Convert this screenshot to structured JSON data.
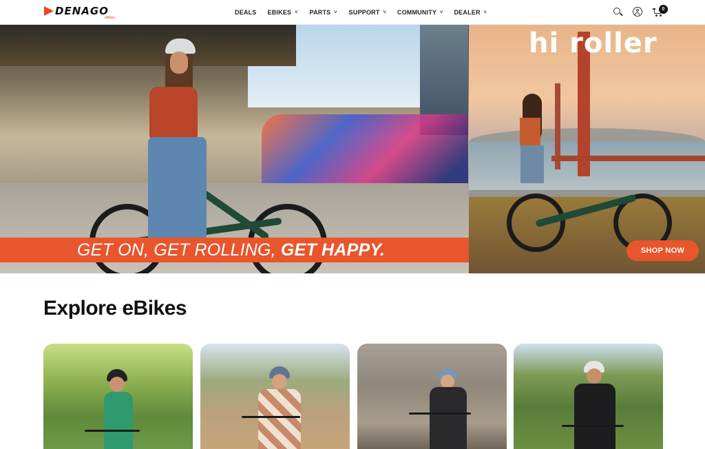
{
  "brand": {
    "name": "DENAGO",
    "tagline": "eBikes",
    "accent_color": "#e9552c"
  },
  "nav": {
    "items": [
      {
        "label": "DEALS",
        "has_dropdown": false
      },
      {
        "label": "EBIKES",
        "has_dropdown": true
      },
      {
        "label": "PARTS",
        "has_dropdown": true
      },
      {
        "label": "SUPPORT",
        "has_dropdown": true
      },
      {
        "label": "COMMUNITY",
        "has_dropdown": true
      },
      {
        "label": "DEALER",
        "has_dropdown": true
      }
    ],
    "chevron": "˅"
  },
  "header_icons": {
    "search": "search-icon",
    "account": "user-icon",
    "cart": "cart-icon",
    "cart_count": "0"
  },
  "hero": {
    "banner_part1": "GET ON, GET ROLLING, ",
    "banner_part2": "GET HAPPY",
    "banner_period": ".",
    "right_title": "hi roller",
    "cta_label": "SHOP NOW"
  },
  "explore": {
    "title": "Explore eBikes",
    "cards": [
      {
        "image": "rider-green-park"
      },
      {
        "image": "rider-checkered-sweater"
      },
      {
        "image": "rider-stone-wall"
      },
      {
        "image": "rider-dark-jacket"
      }
    ]
  }
}
